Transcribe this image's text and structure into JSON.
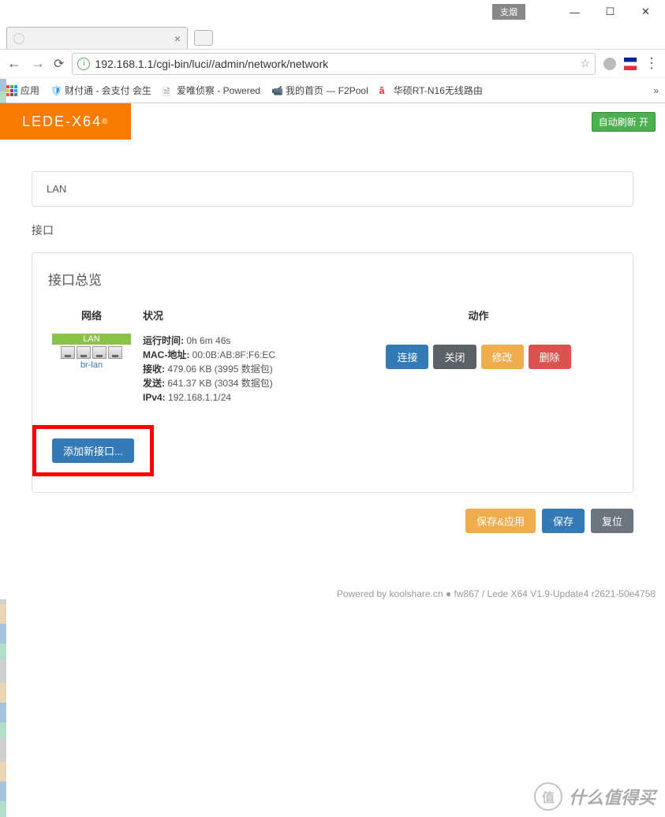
{
  "browser": {
    "dim_btn": "支烟",
    "tab_title": "",
    "url": "192.168.1.1/cgi-bin/luci//admin/network/network",
    "bookmarks": {
      "apps": "应用",
      "caifutong": "财付通 - 会支付 会生",
      "aiwei": "爱唯侦察 - Powered",
      "f2pool": "我的首页 — F2Pool",
      "asus": "华硕RT-N16无线路由",
      "more": "»"
    }
  },
  "page": {
    "brand": "LEDE-X64",
    "brand_sup": "®",
    "auto_refresh": "自动刷新 开",
    "tab_lan": "LAN",
    "section_title": "接口",
    "panel_title": "接口总览",
    "headers": {
      "network": "网络",
      "status": "状况",
      "actions": "动作"
    },
    "iface": {
      "badge": "LAN",
      "bridge": "br-lan",
      "uptime_label": "运行时间:",
      "uptime": "0h 6m 46s",
      "mac_label": "MAC-地址:",
      "mac": "00:0B:AB:8F:F6:EC",
      "rx_label": "接收:",
      "rx": "479.06 KB (3995 数据包)",
      "tx_label": "发送:",
      "tx": "641.37 KB (3034 数据包)",
      "ipv4_label": "IPv4:",
      "ipv4": "192.168.1.1/24"
    },
    "actions": {
      "connect": "连接",
      "close": "关闭",
      "edit": "修改",
      "delete": "删除"
    },
    "add_interface": "添加新接口...",
    "bottom": {
      "save_apply": "保存&应用",
      "save": "保存",
      "reset": "复位"
    },
    "footer": "Powered by koolshare.cn ● fw867 / Lede X64 V1.9-Update4 r2621-50e4758"
  },
  "watermark": {
    "text": "什么值得买",
    "circle": "值"
  }
}
